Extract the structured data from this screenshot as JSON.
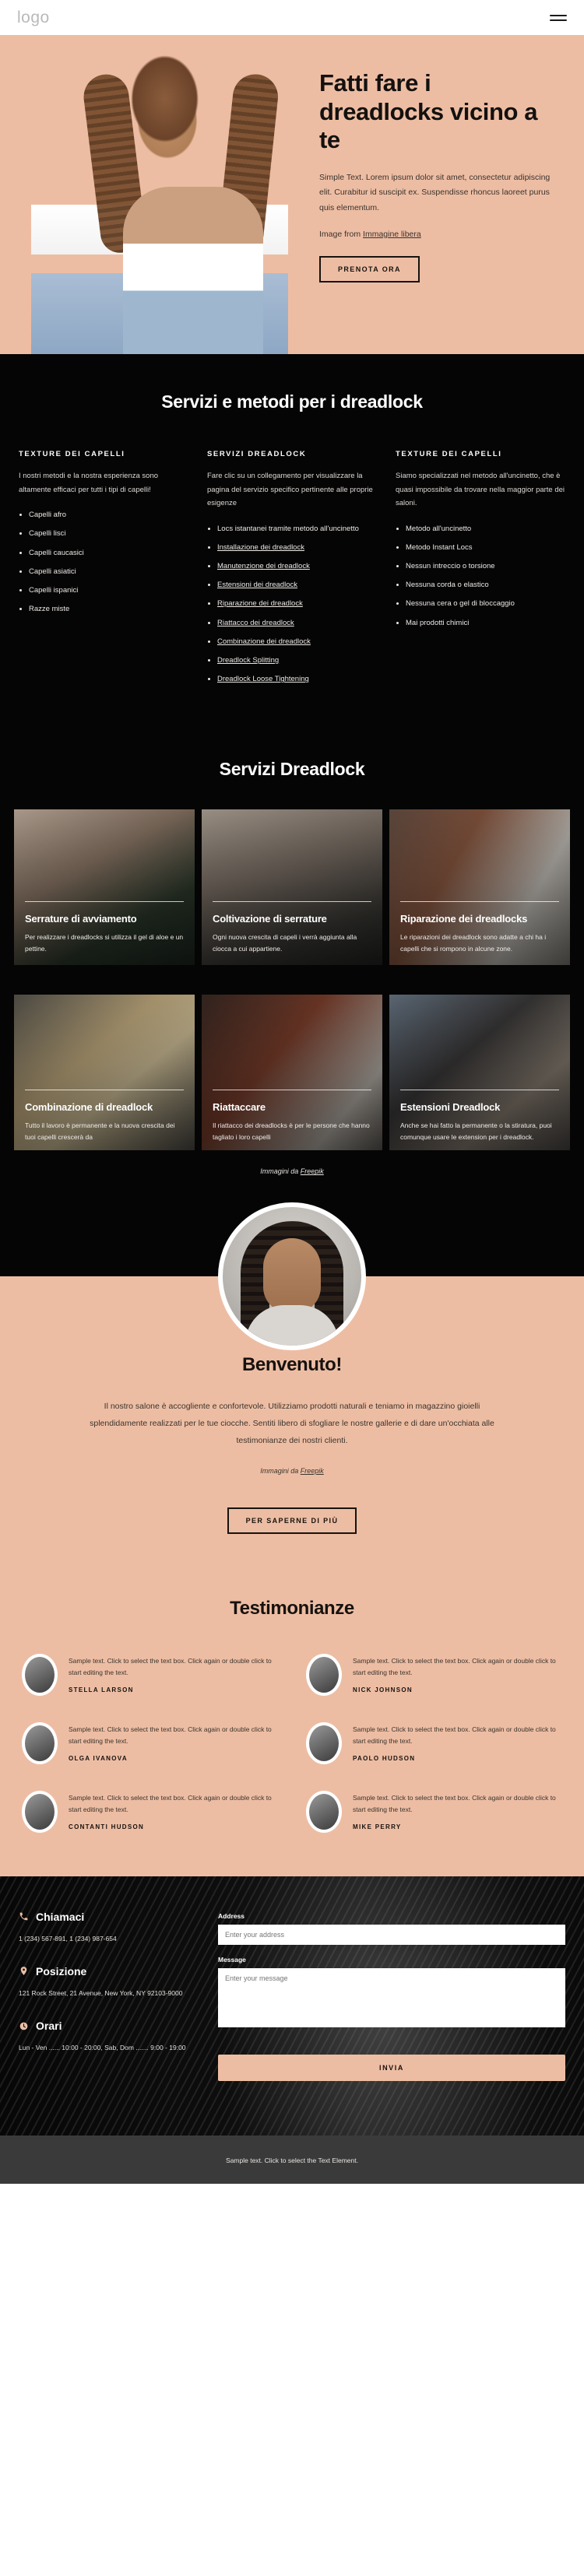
{
  "header": {
    "logo": "logo",
    "menu_icon": "hamburger-menu-icon"
  },
  "hero": {
    "title": "Fatti fare i dreadlocks vicino a te",
    "paragraph": "Simple Text. Lorem ipsum dolor sit amet, consectetur adipiscing elit. Curabitur id suscipit ex. Suspendisse rhoncus laoreet purus quis elementum.",
    "credit_prefix": "Image from ",
    "credit_link": "Immagine libera",
    "cta": "PRENOTA ORA"
  },
  "services_methods": {
    "title": "Servizi e metodi per i dreadlock",
    "columns": [
      {
        "heading": "TEXTURE DEI CAPELLI",
        "intro": "I nostri metodi e la nostra esperienza sono altamente efficaci per tutti i tipi di capelli!",
        "items": [
          {
            "label": "Capelli afro",
            "link": false
          },
          {
            "label": "Capelli lisci",
            "link": false
          },
          {
            "label": "Capelli caucasici",
            "link": false
          },
          {
            "label": "Capelli asiatici",
            "link": false
          },
          {
            "label": "Capelli ispanici",
            "link": false
          },
          {
            "label": "Razze miste",
            "link": false
          }
        ]
      },
      {
        "heading": "SERVIZI DREADLOCK",
        "intro": "Fare clic su un collegamento per visualizzare la pagina del servizio specifico pertinente alle proprie esigenze",
        "items": [
          {
            "label": "Locs istantanei tramite metodo all'uncinetto",
            "link": false
          },
          {
            "label": "Installazione dei dreadlock",
            "link": true
          },
          {
            "label": "Manutenzione dei dreadlock",
            "link": true
          },
          {
            "label": "Estensioni dei dreadlock",
            "link": true
          },
          {
            "label": "Riparazione dei dreadlock",
            "link": true
          },
          {
            "label": "Riattacco dei dreadlock",
            "link": true
          },
          {
            "label": "Combinazione dei dreadlock",
            "link": true
          },
          {
            "label": "Dreadlock Splitting",
            "link": true
          },
          {
            "label": "Dreadlock Loose Tightening",
            "link": true
          }
        ]
      },
      {
        "heading": "TEXTURE DEI CAPELLI",
        "intro": "Siamo specializzati nel metodo all'uncinetto, che è quasi impossibile da trovare nella maggior parte dei saloni.",
        "items": [
          {
            "label": "Metodo all'uncinetto",
            "link": false
          },
          {
            "label": "Metodo Instant Locs",
            "link": false
          },
          {
            "label": "Nessun intreccio o torsione",
            "link": false
          },
          {
            "label": "Nessuna corda o elastico",
            "link": false
          },
          {
            "label": "Nessuna cera o gel di bloccaggio",
            "link": false
          },
          {
            "label": "Mai prodotti chimici",
            "link": false
          }
        ]
      }
    ]
  },
  "gallery": {
    "title": "Servizi Dreadlock",
    "cards": [
      {
        "title": "Serrature di avviamento",
        "text": "Per realizzare i dreadlocks si utilizza il gel di aloe e un pettine."
      },
      {
        "title": "Coltivazione di serrature",
        "text": "Ogni nuova crescita di capeli i verrà aggiunta alla ciocca a cui appartiene."
      },
      {
        "title": "Riparazione dei dreadlocks",
        "text": "Le riparazioni dei dreadlock sono adatte a chi ha i capelli che si rompono in alcune zone."
      },
      {
        "title": "Combinazione di dreadlock",
        "text": "Tutto il lavoro è permanente e la nuova crescita dei tuoi capelli crescerà da"
      },
      {
        "title": "Riattaccare",
        "text": "Il riattacco dei dreadlocks è per le persone che hanno tagliato i loro capelli"
      },
      {
        "title": "Estensioni Dreadlock",
        "text": "Anche se hai fatto la permanente o la stiratura, puoi comunque usare le extension per i dreadlock."
      }
    ],
    "credit_prefix": "Immagini da ",
    "credit_link": "Freepik"
  },
  "welcome": {
    "title": "Benvenuto!",
    "paragraph": "Il nostro salone è accogliente e confortevole. Utilizziamo prodotti naturali e teniamo in magazzino gioielli splendidamente realizzati per le tue ciocche. Sentiti libero di sfogliare le nostre gallerie e di dare un'occhiata alle testimonianze dei nostri clienti.",
    "credit_prefix": "Immagini da ",
    "credit_link": "Freepik",
    "cta": "PER SAPERNE DI PIÙ"
  },
  "testimonials": {
    "title": "Testimonianze",
    "items": [
      {
        "text": "Sample text. Click to select the text box. Click again or double click to start editing the text.",
        "name": "STELLA LARSON"
      },
      {
        "text": "Sample text. Click to select the text box. Click again or double click to start editing the text.",
        "name": "NICK JOHNSON"
      },
      {
        "text": "Sample text. Click to select the text box. Click again or double click to start editing the text.",
        "name": "OLGA IVANOVA"
      },
      {
        "text": "Sample text. Click to select the text box. Click again or double click to start editing the text.",
        "name": "PAOLO HUDSON"
      },
      {
        "text": "Sample text. Click to select the text box. Click again or double click to start editing the text.",
        "name": "CONTANTI HUDSON"
      },
      {
        "text": "Sample text. Click to select the text box. Click again or double click to start editing the text.",
        "name": "MIKE PERRY"
      }
    ]
  },
  "contact": {
    "blocks": [
      {
        "icon": "phone-icon",
        "heading": "Chiamaci",
        "text": "1 (234) 567-891, 1 (234) 987-654"
      },
      {
        "icon": "location-pin-icon",
        "heading": "Posizione",
        "text": "121 Rock Street, 21 Avenue, New York, NY 92103-9000"
      },
      {
        "icon": "clock-icon",
        "heading": "Orari",
        "text": "Lun - Ven ...... 10:00 - 20:00, Sab, Dom ....... 9:00 - 19:00"
      }
    ],
    "form": {
      "address_label": "Address",
      "address_placeholder": "Enter your address",
      "address_value": "",
      "message_label": "Message",
      "message_placeholder": "Enter your message",
      "message_value": "",
      "submit": "INVIA"
    }
  },
  "footer": {
    "text": "Sample text. Click to select the Text Element."
  },
  "colors": {
    "accent": "#edbda3",
    "dark": "#050505",
    "footer": "#3a3a3a"
  }
}
